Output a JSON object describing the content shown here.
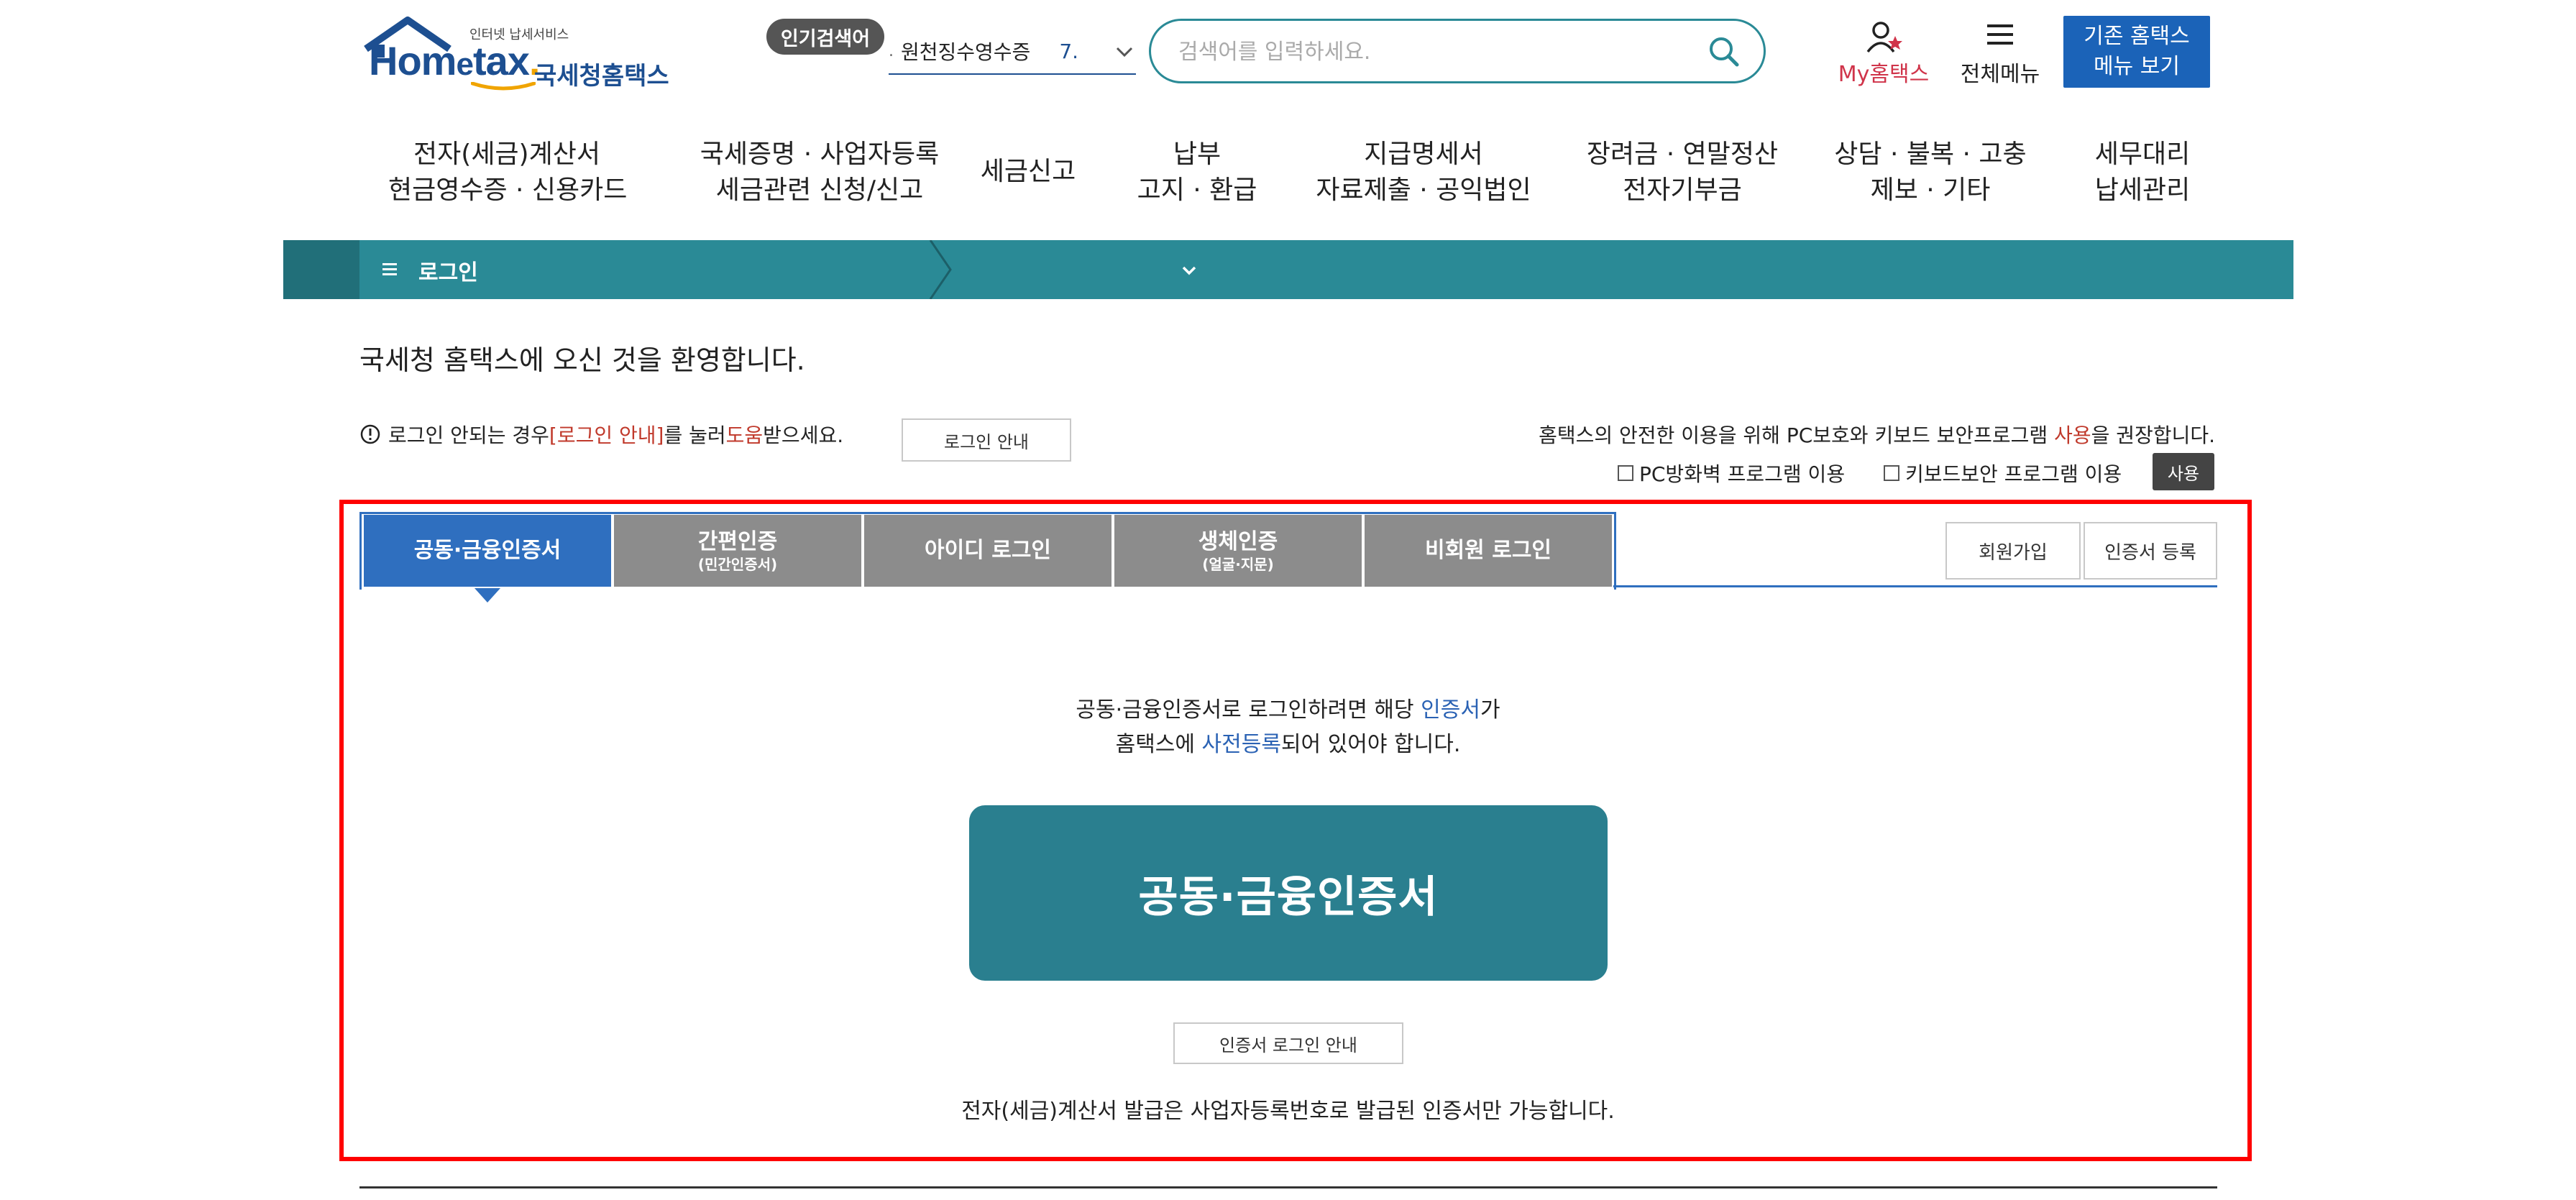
{
  "header": {
    "logo_small": "인터넷 납세서비스",
    "logo_brand_1": "Hom",
    "logo_brand_2": "e",
    "logo_brand_3": "tax",
    "logo_dot": ".",
    "logo_kor": "국세청홈택스",
    "popular_label": "인기검색어",
    "popular_num": ".",
    "popular_term": "원천징수영수증",
    "popular_rank": "7.",
    "search_placeholder": "검색어를 입력하세요.",
    "my_hometax": "My홈택스",
    "all_menu": "전체메뉴",
    "legacy_line1": "기존 홈택스",
    "legacy_line2": "메뉴 보기"
  },
  "gnb": [
    {
      "l1": "전자(세금)계산서",
      "l2": "현금영수증 · 신용카드"
    },
    {
      "l1": "국세증명 · 사업자등록",
      "l2": "세금관련 신청/신고"
    },
    {
      "l1": "세금신고",
      "l2": ""
    },
    {
      "l1": "납부",
      "l2": "고지 · 환급"
    },
    {
      "l1": "지급명세서",
      "l2": "자료제출 · 공익법인"
    },
    {
      "l1": "장려금 · 연말정산",
      "l2": "전자기부금"
    },
    {
      "l1": "상담 · 불복 · 고충",
      "l2": "제보 · 기타"
    },
    {
      "l1": "세무대리",
      "l2": "납세관리"
    }
  ],
  "breadcrumb": {
    "label": "로그인"
  },
  "welcome": "국세청 홈택스에 오신 것을 환영합니다.",
  "help": {
    "text_a": "로그인 안되는 경우 ",
    "text_link": "[로그인 안내]",
    "text_b": "를 눌러 ",
    "text_red": "도움",
    "text_c": "받으세요.",
    "button": "로그인 안내"
  },
  "security": {
    "text_a": "홈택스의 안전한 이용을 위해 PC보호와 키보드 보안프로그램 ",
    "text_red": "사용",
    "text_b": "을 권장합니다.",
    "pc_firewall": "PC방화벽 프로그램 이용",
    "keyboard": "키보드보안 프로그램 이용",
    "use_button": "사용"
  },
  "tabs": [
    {
      "label": "공동·금융인증서",
      "sub": ""
    },
    {
      "label": "간편인증",
      "sub": "(민간인증서)"
    },
    {
      "label": "아이디 로그인",
      "sub": ""
    },
    {
      "label": "생체인증",
      "sub": "(얼굴·지문)"
    },
    {
      "label": "비회원 로그인",
      "sub": ""
    }
  ],
  "side_buttons": {
    "signup": "회원가입",
    "cert_register": "인증서 등록"
  },
  "content": {
    "line1_a": "공동·금융인증서로 로그인하려면 해당 ",
    "line1_blue": "인증서",
    "line1_b": "가",
    "line2_a": "홈택스에 ",
    "line2_blue": "사전등록",
    "line2_b": "되어 있어야 합니다.",
    "cert_button": "공동·금융인증서",
    "cert_guide": "인증서 로그인 안내",
    "bottom_note": "전자(세금)계산서 발급은 사업자등록번호로 발급된 인증서만 가능합니다."
  },
  "colors": {
    "teal": "#2a8a96",
    "brand_blue": "#1d4f91",
    "tab_active": "#2f6fbf",
    "highlight_frame": "#ff0000"
  }
}
